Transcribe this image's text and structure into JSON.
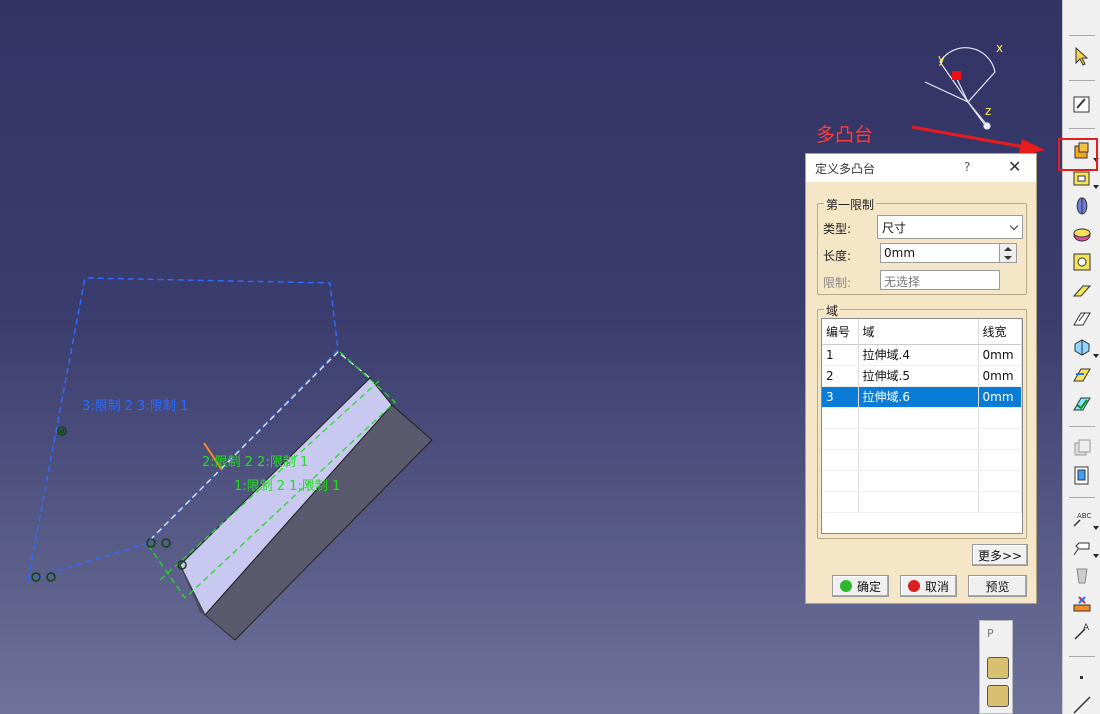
{
  "annotation": {
    "feature_name": "多凸台",
    "color": "#ff3b3b"
  },
  "viewport": {
    "labels": {
      "limit3": "3:限制 2 3:限制 1",
      "limit2": "2:限制 2 2:限制 1",
      "limit1": "1:限制 2 1:限制 1"
    },
    "compass": {
      "x": "x",
      "y": "y",
      "z": "z"
    }
  },
  "dialog": {
    "title": "定义多凸台",
    "help": "?",
    "close": "✕",
    "first_limit": {
      "group_label": "第一限制",
      "type_label": "类型:",
      "type_value": "尺寸",
      "length_label": "长度:",
      "length_value": "0mm",
      "limit_label": "限制:",
      "limit_value": "无选择"
    },
    "domain": {
      "group_label": "域",
      "columns": [
        "编号",
        "域",
        "线宽"
      ],
      "rows": [
        [
          "1",
          "拉伸域.4",
          "0mm"
        ],
        [
          "2",
          "拉伸域.5",
          "0mm"
        ],
        [
          "3",
          "拉伸域.6",
          "0mm"
        ]
      ],
      "selected_row": 3
    },
    "more_button": "更多>>",
    "ok_button": "确定",
    "cancel_button": "取消",
    "preview_button": "预览"
  },
  "mini_panel": {
    "title": "P"
  },
  "colors": {
    "selection": "#0a7bd7",
    "dialog_bg": "#f5e6c8",
    "highlight": "#e02020"
  }
}
